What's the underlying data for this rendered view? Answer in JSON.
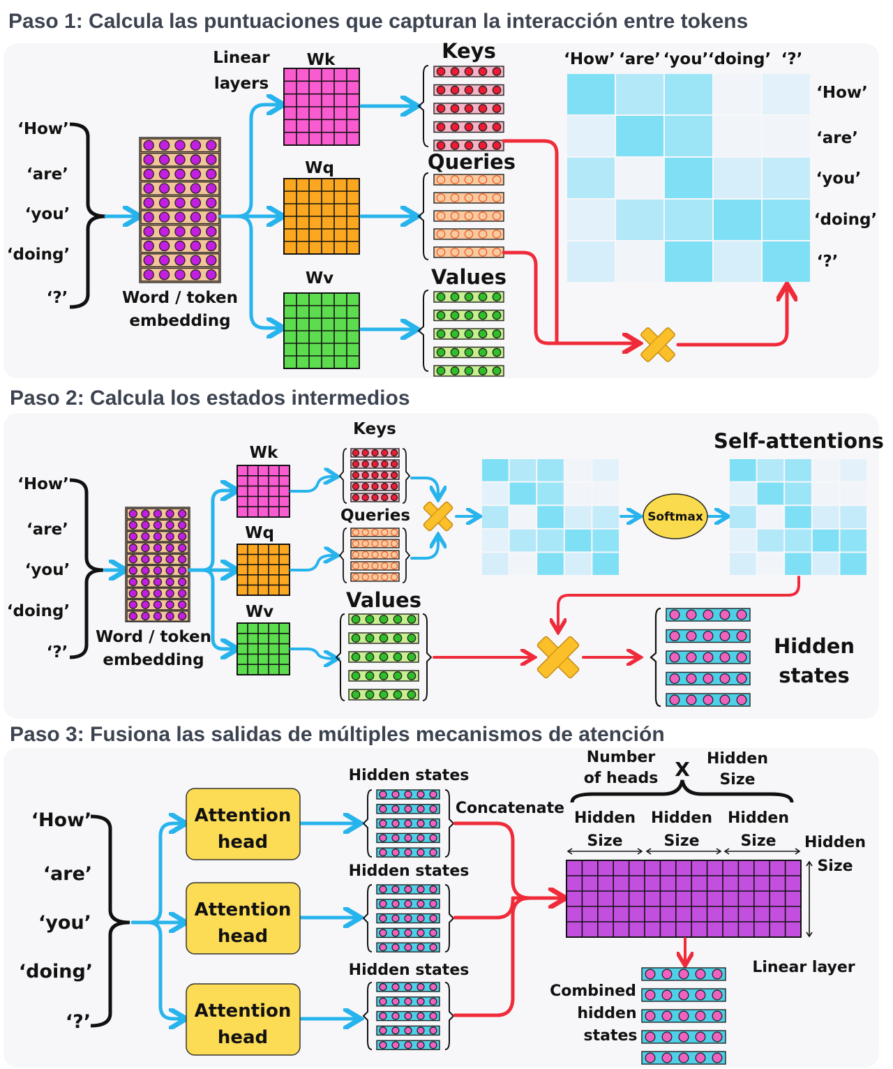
{
  "colors": {
    "blue_arrow": "#27b3ec",
    "red_arrow": "#ef2b3a",
    "wk": "#f95bd0",
    "wq": "#fba820",
    "wv": "#5ddc4f",
    "embedding_bg": "#f4c59a",
    "embedding_dot": "#c21fe0",
    "x_mark": "#fbbf2a",
    "attention_head": "#fcdb55",
    "hidden_bg": "#4fd0e8",
    "hidden_dot": "#f062c0",
    "linear_layer": "#c34fdf"
  },
  "tokens": [
    "‘How’",
    "‘are’",
    "‘you’",
    "‘doing’",
    "‘?’"
  ],
  "step1": {
    "title": "Paso 1: Calcula las puntuaciones que capturan la interacción entre tokens",
    "linear_layers": [
      "Linear",
      "layers"
    ],
    "wk": "Wk",
    "wq": "Wq",
    "wv": "Wv",
    "keys": "Keys",
    "queries": "Queries",
    "values": "Values",
    "embedding": [
      "Word / token",
      "embedding"
    ],
    "scores_levels": [
      [
        4,
        2,
        3,
        0,
        0.5
      ],
      [
        0.5,
        4,
        3,
        0,
        0
      ],
      [
        2,
        0,
        4,
        1,
        1.5
      ],
      [
        0.5,
        2,
        2.5,
        4,
        3.5
      ],
      [
        1,
        0,
        4,
        1,
        4
      ]
    ]
  },
  "step2": {
    "title": "Paso 2: Calcula los estados intermedios",
    "wk": "Wk",
    "wq": "Wq",
    "wv": "Wv",
    "keys": "Keys",
    "queries": "Queries",
    "values": "Values",
    "embedding": [
      "Word / token",
      "embedding"
    ],
    "softmax": "Softmax",
    "self_attentions": "Self-attentions",
    "hidden_states": [
      "Hidden",
      "states"
    ]
  },
  "step3": {
    "title": "Paso 3: Fusiona las salidas de múltiples mecanismos de atención",
    "attention_head": [
      "Attention",
      "head"
    ],
    "hidden_states": "Hidden states",
    "concatenate": "Concatenate",
    "number_of_heads": [
      "Number",
      "of heads"
    ],
    "times": "X",
    "hidden_size": [
      "Hidden",
      "Size"
    ],
    "linear_layer": "Linear layer",
    "combined": [
      "Combined",
      "hidden",
      "states"
    ]
  }
}
